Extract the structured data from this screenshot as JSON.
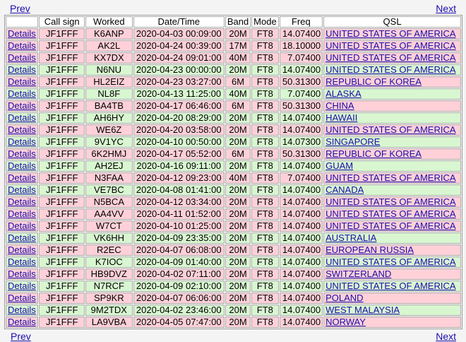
{
  "nav": {
    "prev_label": "Prev",
    "next_label": "Next"
  },
  "columns": [
    "",
    "Call sign",
    "Worked",
    "Date/Time",
    "Band",
    "Mode",
    "Freq",
    "QSL"
  ],
  "details_label": "Details",
  "row_colors": {
    "pink": "#ffd0d8",
    "green": "#d8f6d0"
  },
  "rows": [
    {
      "call": "JF1FFF",
      "worked": "K6ANP",
      "datetime": "2020-04-03 00:09:00",
      "band": "20M",
      "mode": "FT8",
      "freq": "14.07400",
      "qsl": "UNITED STATES OF AMERICA",
      "color": "pink"
    },
    {
      "call": "JF1FFF",
      "worked": "AK2L",
      "datetime": "2020-04-24 00:39:00",
      "band": "17M",
      "mode": "FT8",
      "freq": "18.10000",
      "qsl": "UNITED STATES OF AMERICA",
      "color": "pink"
    },
    {
      "call": "JF1FFF",
      "worked": "KX7DX",
      "datetime": "2020-04-24 09:01:00",
      "band": "40M",
      "mode": "FT8",
      "freq": "7.07400",
      "qsl": "UNITED STATES OF AMERICA",
      "color": "pink"
    },
    {
      "call": "JF1FFF",
      "worked": "N6NU",
      "datetime": "2020-04-23 00:00:00",
      "band": "20M",
      "mode": "FT8",
      "freq": "14.07400",
      "qsl": "UNITED STATES OF AMERICA",
      "color": "green"
    },
    {
      "call": "JF1FFF",
      "worked": "HL2EIZ",
      "datetime": "2020-04-23 03:27:00",
      "band": "6M",
      "mode": "FT8",
      "freq": "50.31300",
      "qsl": "REPUBLIC OF KOREA",
      "color": "pink"
    },
    {
      "call": "JF1FFF",
      "worked": "NL8F",
      "datetime": "2020-04-13 11:25:00",
      "band": "40M",
      "mode": "FT8",
      "freq": "7.07400",
      "qsl": "ALASKA",
      "color": "green"
    },
    {
      "call": "JF1FFF",
      "worked": "BA4TB",
      "datetime": "2020-04-17 06:46:00",
      "band": "6M",
      "mode": "FT8",
      "freq": "50.31300",
      "qsl": "CHINA",
      "color": "pink"
    },
    {
      "call": "JF1FFF",
      "worked": "AH6HY",
      "datetime": "2020-04-20 08:29:00",
      "band": "20M",
      "mode": "FT8",
      "freq": "14.07400",
      "qsl": "HAWAII",
      "color": "green"
    },
    {
      "call": "JF1FFF",
      "worked": "WE6Z",
      "datetime": "2020-04-20 03:58:00",
      "band": "20M",
      "mode": "FT8",
      "freq": "14.07400",
      "qsl": "UNITED STATES OF AMERICA",
      "color": "pink"
    },
    {
      "call": "JF1FFF",
      "worked": "9V1YC",
      "datetime": "2020-04-10 00:50:00",
      "band": "20M",
      "mode": "FT8",
      "freq": "14.07300",
      "qsl": "SINGAPORE",
      "color": "green"
    },
    {
      "call": "JF1FFF",
      "worked": "6K2HMJ",
      "datetime": "2020-04-17 05:52:00",
      "band": "6M",
      "mode": "FT8",
      "freq": "50.31300",
      "qsl": "REPUBLIC OF KOREA",
      "color": "pink"
    },
    {
      "call": "JF1FFF",
      "worked": "AH2EJ",
      "datetime": "2020-04-16 09:11:00",
      "band": "20M",
      "mode": "FT8",
      "freq": "14.07400",
      "qsl": "GUAM",
      "color": "green"
    },
    {
      "call": "JF1FFF",
      "worked": "N3FAA",
      "datetime": "2020-04-12 09:23:00",
      "band": "40M",
      "mode": "FT8",
      "freq": "7.07400",
      "qsl": "UNITED STATES OF AMERICA",
      "color": "pink"
    },
    {
      "call": "JF1FFF",
      "worked": "VE7BC",
      "datetime": "2020-04-08 01:41:00",
      "band": "20M",
      "mode": "FT8",
      "freq": "14.07400",
      "qsl": "CANADA",
      "color": "green"
    },
    {
      "call": "JF1FFF",
      "worked": "N5BCA",
      "datetime": "2020-04-12 03:34:00",
      "band": "20M",
      "mode": "FT8",
      "freq": "14.07400",
      "qsl": "UNITED STATES OF AMERICA",
      "color": "pink"
    },
    {
      "call": "JF1FFF",
      "worked": "AA4VV",
      "datetime": "2020-04-11 01:52:00",
      "band": "20M",
      "mode": "FT8",
      "freq": "14.07400",
      "qsl": "UNITED STATES OF AMERICA",
      "color": "pink"
    },
    {
      "call": "JF1FFF",
      "worked": "W7CT",
      "datetime": "2020-04-10 01:25:00",
      "band": "20M",
      "mode": "FT8",
      "freq": "14.07400",
      "qsl": "UNITED STATES OF AMERICA",
      "color": "pink"
    },
    {
      "call": "JF1FFF",
      "worked": "VK6HH",
      "datetime": "2020-04-09 23:35:00",
      "band": "20M",
      "mode": "FT8",
      "freq": "14.07400",
      "qsl": "AUSTRALIA",
      "color": "green"
    },
    {
      "call": "JF1FFF",
      "worked": "R2EC",
      "datetime": "2020-04-07 06:08:00",
      "band": "20M",
      "mode": "FT8",
      "freq": "14.07400",
      "qsl": "EUROPEAN RUSSIA",
      "color": "pink"
    },
    {
      "call": "JF1FFF",
      "worked": "K7IOC",
      "datetime": "2020-04-09 01:40:00",
      "band": "20M",
      "mode": "FT8",
      "freq": "14.07400",
      "qsl": "UNITED STATES OF AMERICA",
      "color": "green"
    },
    {
      "call": "JF1FFF",
      "worked": "HB9DVZ",
      "datetime": "2020-04-02 07:11:00",
      "band": "20M",
      "mode": "FT8",
      "freq": "14.07400",
      "qsl": "SWITZERLAND",
      "color": "pink"
    },
    {
      "call": "JF1FFF",
      "worked": "N7RCF",
      "datetime": "2020-04-09 02:10:00",
      "band": "20M",
      "mode": "FT8",
      "freq": "14.07400",
      "qsl": "UNITED STATES OF AMERICA",
      "color": "green"
    },
    {
      "call": "JF1FFF",
      "worked": "SP9KR",
      "datetime": "2020-04-07 06:06:00",
      "band": "20M",
      "mode": "FT8",
      "freq": "14.07400",
      "qsl": "POLAND",
      "color": "pink"
    },
    {
      "call": "JF1FFF",
      "worked": "9M2TDX",
      "datetime": "2020-04-02 23:46:00",
      "band": "20M",
      "mode": "FT8",
      "freq": "14.07400",
      "qsl": "WEST MALAYSIA",
      "color": "green"
    },
    {
      "call": "JF1FFF",
      "worked": "LA9VBA",
      "datetime": "2020-04-05 07:47:00",
      "band": "20M",
      "mode": "FT8",
      "freq": "14.07400",
      "qsl": "NORWAY",
      "color": "pink"
    }
  ]
}
